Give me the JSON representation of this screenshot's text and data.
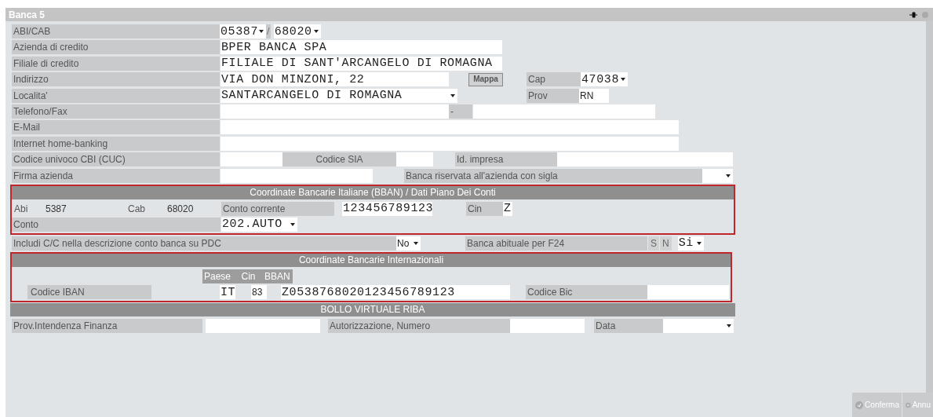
{
  "window": {
    "title": "Banca 5"
  },
  "abi_cab": {
    "label": "ABI/CAB",
    "abi": "05387",
    "separator": "/",
    "cab": "68020"
  },
  "azienda": {
    "label": "Azienda di credito",
    "value": "BPER BANCA SPA"
  },
  "filiale": {
    "label": "Filiale di credito",
    "value": "FILIALE DI SANT'ARCANGELO DI ROMAGNA"
  },
  "indirizzo": {
    "label": "Indirizzo",
    "value": "VIA DON MINZONI, 22",
    "map_button": "Mappa",
    "cap_label": "Cap",
    "cap": "47038"
  },
  "localita": {
    "label": "Localita'",
    "value": "SANTARCANGELO DI ROMAGNA",
    "prov_label": "Prov",
    "prov": "RN"
  },
  "telefono": {
    "label": "Telefono/Fax",
    "separator": "-"
  },
  "email": {
    "label": "E-Mail"
  },
  "home_banking": {
    "label": "Internet home-banking"
  },
  "cbi": {
    "label": "Codice univoco CBI (CUC)",
    "sia_label": "Codice SIA",
    "impresa_label": "Id. impresa"
  },
  "firma": {
    "label": "Firma azienda",
    "reserved_label": "Banca riservata all'azienda con sigla"
  },
  "bban": {
    "title": "Coordinate Bancarie Italiane (BBAN) / Dati Piano Dei Conti",
    "abi_label": "Abi",
    "abi": "5387",
    "cab_label": "Cab",
    "cab": "68020",
    "cc_label": "Conto corrente",
    "cc": "123456789123",
    "cin_label": "Cin",
    "cin": "Z",
    "conto_label": "Conto",
    "conto": "202.AUTO"
  },
  "includi": {
    "label": "Includi C/C nella descrizione conto banca su PDC",
    "value": "No",
    "f24_label": "Banca abituale per F24",
    "f24_options": [
      "S",
      "N"
    ],
    "f24_value": "Si"
  },
  "iban": {
    "title": "Coordinate Bancarie Internazionali",
    "paese_label": "Paese",
    "cin_label": "Cin",
    "bban_label": "BBAN",
    "label": "Codice IBAN",
    "paese": "IT",
    "cin": "83",
    "bban": "Z0538768020123456789123",
    "bic_label": "Codice Bic"
  },
  "bollo": {
    "title": "BOLLO VIRTUALE RIBA",
    "prov_label": "Prov.Intendenza Finanza",
    "auth_label": "Autorizzazione, Numero",
    "data_label": "Data"
  },
  "buttons": [
    {
      "kind": "confirm",
      "label": "Conferma"
    },
    {
      "kind": "cancel",
      "label": "Annu"
    }
  ]
}
